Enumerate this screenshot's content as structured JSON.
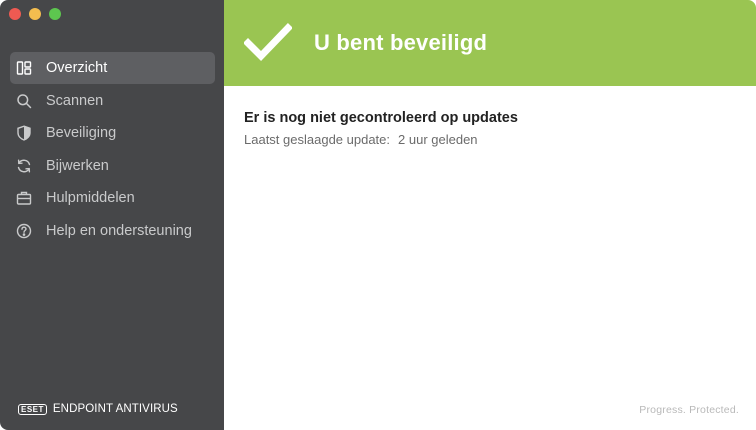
{
  "window": {
    "controls": [
      "close",
      "minimize",
      "maximize"
    ]
  },
  "sidebar": {
    "items": [
      {
        "label": "Overzicht",
        "icon": "overview-icon",
        "active": true
      },
      {
        "label": "Scannen",
        "icon": "search-icon",
        "active": false
      },
      {
        "label": "Beveiliging",
        "icon": "shield-icon",
        "active": false
      },
      {
        "label": "Bijwerken",
        "icon": "refresh-icon",
        "active": false
      },
      {
        "label": "Hulpmiddelen",
        "icon": "briefcase-icon",
        "active": false
      },
      {
        "label": "Help en ondersteuning",
        "icon": "help-icon",
        "active": false
      }
    ],
    "brand": {
      "logo": "eset",
      "product": "ENDPOINT ANTIVIRUS"
    }
  },
  "status": {
    "title": "U bent beveiligd",
    "color": "#9ac552"
  },
  "updates": {
    "title": "Er is nog niet gecontroleerd op updates",
    "last_label": "Laatst geslaagde update:",
    "last_value": "2 uur geleden"
  },
  "footer": {
    "tagline": "Progress. Protected."
  },
  "colors": {
    "sidebar_bg": "#464749",
    "sidebar_active": "#5e5f62",
    "accent_green": "#9ac552"
  }
}
